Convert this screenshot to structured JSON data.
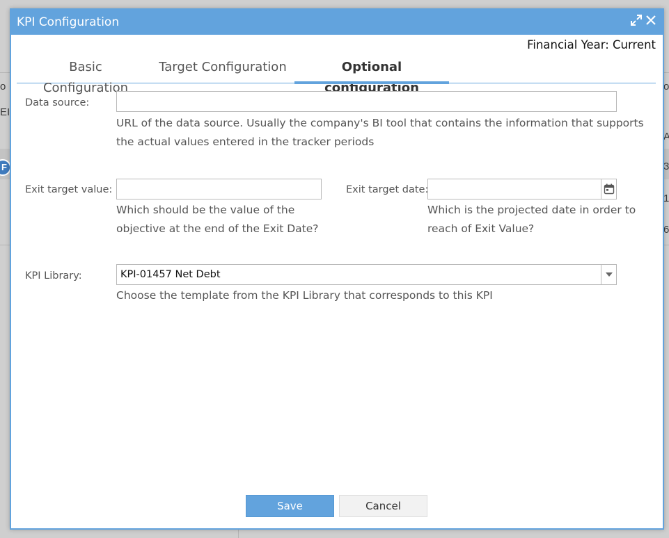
{
  "background": {
    "fragments": [
      "o",
      "EI",
      "F",
      "o",
      "A",
      "3:",
      "1",
      "6"
    ]
  },
  "dialog": {
    "title": "KPI Configuration",
    "icons": {
      "maximize": "expand-icon",
      "close": "close-icon"
    },
    "financial_year": "Financial Year: Current",
    "tabs": [
      {
        "label": "Basic Configuration",
        "active": false
      },
      {
        "label": "Target Configuration",
        "active": false
      },
      {
        "label": "Optional configuration",
        "active": true
      }
    ],
    "data_source": {
      "label": "Data source:",
      "value": "",
      "help": [
        "URL of the data source. Usually the company's BI tool that contains the information that supports",
        "the actual values entered in the tracker periods"
      ]
    },
    "exit_target_value": {
      "label": "Exit target value:",
      "value": "",
      "help": [
        "Which should be the value of the",
        "objective at the end of the Exit Date?"
      ]
    },
    "exit_target_date": {
      "label": "Exit target date:",
      "value": "",
      "icon": "calendar-icon",
      "help": [
        "Which is the projected date in order to",
        "reach of Exit Value?"
      ]
    },
    "kpi_library": {
      "label": "KPI Library:",
      "selected": "KPI-01457 Net Debt",
      "icon": "caret-down-icon",
      "help": "Choose the template from the KPI Library that corresponds to this KPI"
    },
    "buttons": {
      "save": "Save",
      "cancel": "Cancel"
    },
    "colors": {
      "accent": "#62a3dd",
      "text": "#555555"
    }
  }
}
